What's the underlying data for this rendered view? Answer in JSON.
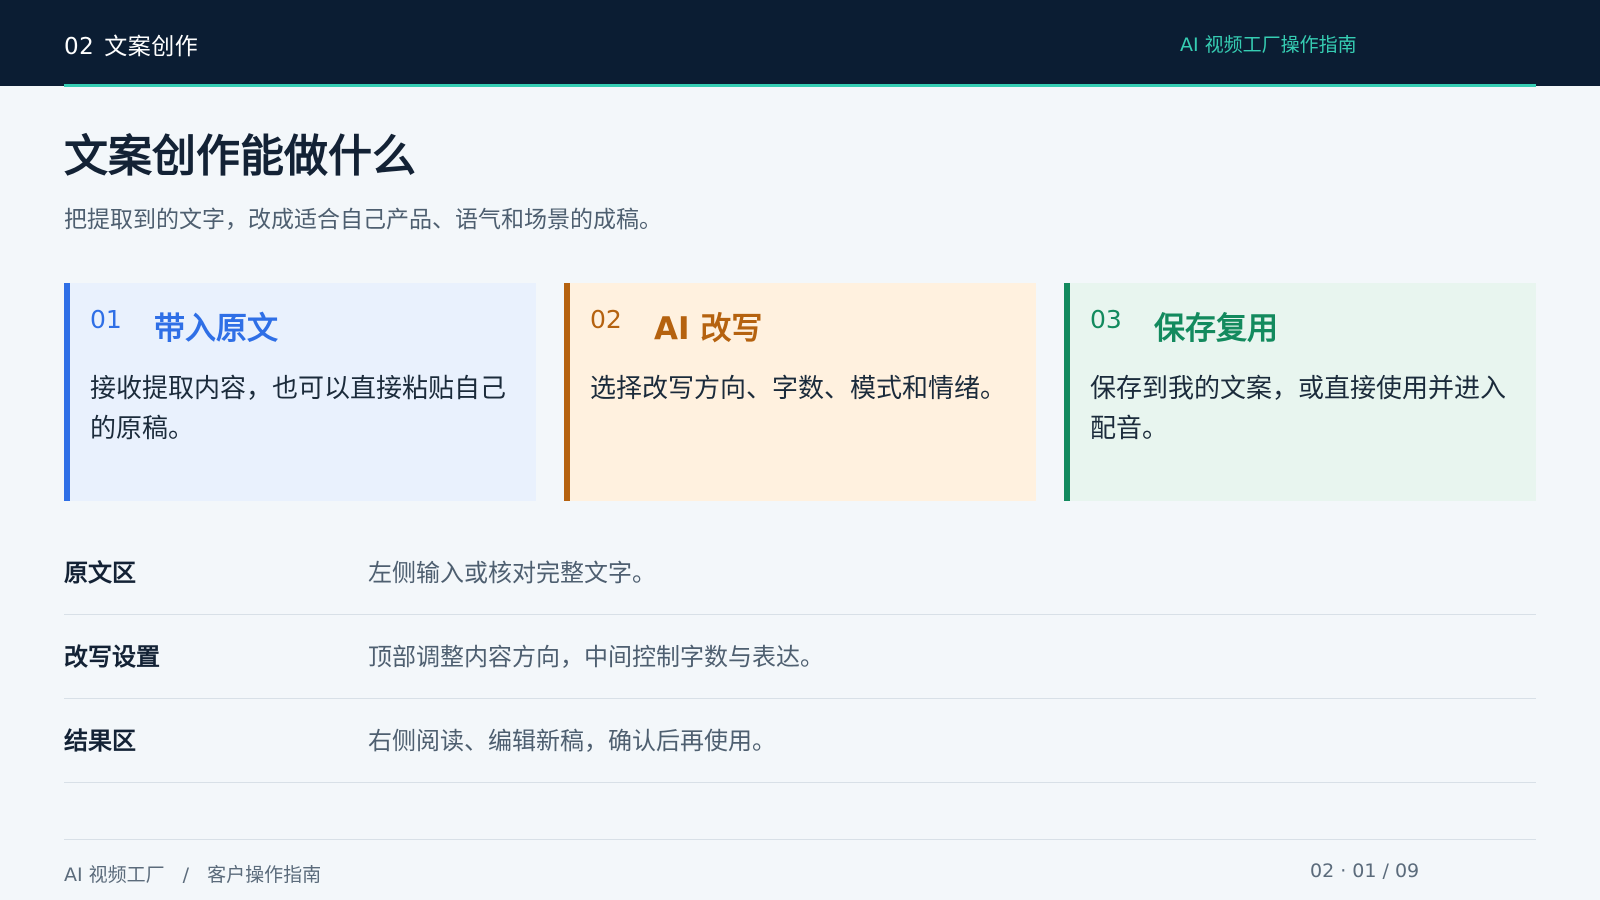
{
  "header": {
    "section_number": "02",
    "section_title": "文案创作",
    "brand_title": "AI 视频工厂操作指南",
    "accent_color": "#36cdb3",
    "background_color": "#0b1d33"
  },
  "page": {
    "title": "文案创作能做什么",
    "subtitle": "把提取到的文字，改成适合自己产品、语气和场景的成稿。"
  },
  "cards": [
    {
      "number": "01",
      "title": "带入原文",
      "body": "接收提取内容，也可以直接粘贴自己的原稿。",
      "accent": "#2f6fe6"
    },
    {
      "number": "02",
      "title": "AI 改写",
      "body": "选择改写方向、字数、模式和情绪。",
      "accent": "#b5620f"
    },
    {
      "number": "03",
      "title": "保存复用",
      "body": "保存到我的文案，或直接使用并进入配音。",
      "accent": "#138a5e"
    }
  ],
  "rows": [
    {
      "label": "原文区",
      "description": "左侧输入或核对完整文字。"
    },
    {
      "label": "改写设置",
      "description": "顶部调整内容方向，中间控制字数与表达。"
    },
    {
      "label": "结果区",
      "description": "右侧阅读、编辑新稿，确认后再使用。"
    }
  ],
  "footer": {
    "product": "AI 视频工厂",
    "separator": "/",
    "doc_name": "客户操作指南",
    "page_indicator": "02 · 01 / 09"
  }
}
